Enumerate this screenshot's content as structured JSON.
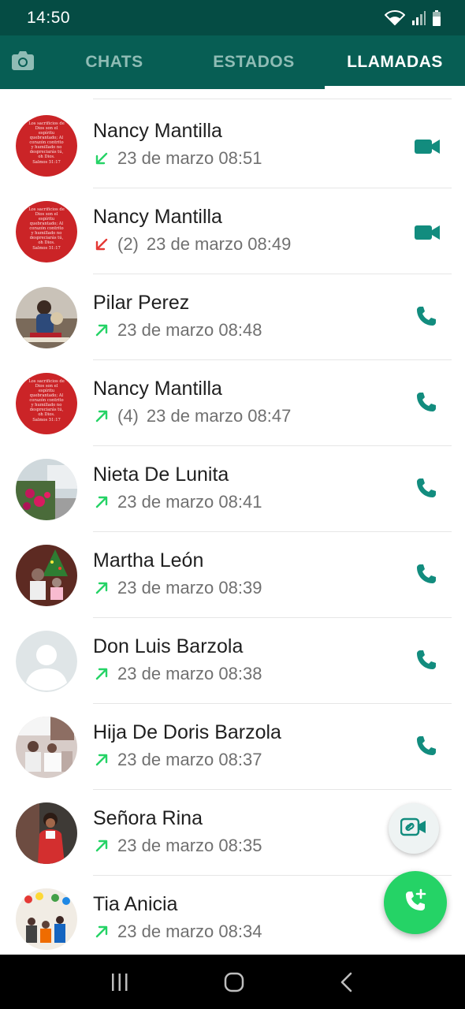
{
  "status_bar": {
    "time": "14:50"
  },
  "tabs": {
    "chats": "CHATS",
    "estados": "ESTADOS",
    "llamadas": "LLAMADAS",
    "active": "llamadas"
  },
  "colors": {
    "header": "#075e54",
    "status_bar": "#054c44",
    "accent": "#128c7e",
    "fab": "#25d366",
    "incoming_arrow": "#25d366",
    "missed_arrow": "#e53935",
    "outgoing_arrow": "#25d366"
  },
  "calls": [
    {
      "name": "Nancy Mantilla",
      "direction": "incoming",
      "count": "",
      "time": "23 de marzo 08:51",
      "type": "video",
      "avatar": "red-verse-card"
    },
    {
      "name": "Nancy Mantilla",
      "direction": "missed",
      "count": "(2)",
      "time": "23 de marzo 08:49",
      "type": "video",
      "avatar": "red-verse-card"
    },
    {
      "name": "Pilar Perez",
      "direction": "outgoing",
      "count": "",
      "time": "23 de marzo 08:48",
      "type": "voice",
      "avatar": "photo-person-with-dog"
    },
    {
      "name": "Nancy Mantilla",
      "direction": "outgoing",
      "count": "(4)",
      "time": "23 de marzo 08:47",
      "type": "voice",
      "avatar": "red-verse-card"
    },
    {
      "name": "Nieta De Lunita",
      "direction": "outgoing",
      "count": "",
      "time": "23 de marzo 08:41",
      "type": "voice",
      "avatar": "photo-flowers"
    },
    {
      "name": "Martha León",
      "direction": "outgoing",
      "count": "",
      "time": "23 de marzo 08:39",
      "type": "voice",
      "avatar": "photo-children-christmas"
    },
    {
      "name": "Don Luis Barzola",
      "direction": "outgoing",
      "count": "",
      "time": "23 de marzo 08:38",
      "type": "voice",
      "avatar": "default-silhouette"
    },
    {
      "name": "Hija De Doris Barzola",
      "direction": "outgoing",
      "count": "",
      "time": "23 de marzo 08:37",
      "type": "voice",
      "avatar": "photo-group-indoor"
    },
    {
      "name": "Señora Rina",
      "direction": "outgoing",
      "count": "",
      "time": "23 de marzo 08:35",
      "type": "voice",
      "avatar": "photo-woman-red-dress"
    },
    {
      "name": "Tia Anicia",
      "direction": "outgoing",
      "count": "",
      "time": "23 de marzo 08:34",
      "type": "voice",
      "avatar": "photo-family-party"
    }
  ],
  "fabs": {
    "video_link": "link-video-icon",
    "new_call": "add-call-icon"
  },
  "avatar_verse_text": "Los sacrificios de Dios son el espíritu quebrantado; Al corazón contrito y humillado no despreciarás tú, oh Dios. Salmos 51:17"
}
